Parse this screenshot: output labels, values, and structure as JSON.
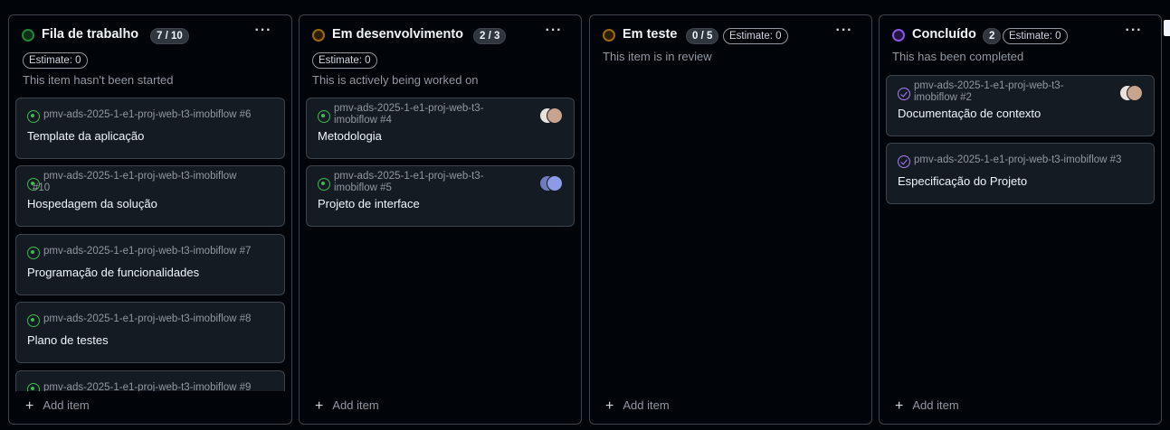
{
  "repo_prefix": "pmv-ads-2025-1-e1-proj-web-t3-imobiflow",
  "add_item_label": "Add item",
  "more_icon": "kebab-horizontal-icon",
  "colors": {
    "todo": "#238636",
    "in_progress": "#9e6a03",
    "review": "#9e6a03",
    "done": "#8957e5",
    "open_issue": "#3fb950",
    "closed_issue": "#ab7df8"
  },
  "columns": [
    {
      "title": "Fila de trabalho",
      "count": "7 / 10",
      "estimate": "Estimate: 0",
      "description": "This item hasn't been started",
      "cards": [
        {
          "ref_line1": "pmv-ads-2025-1-e1-proj-web-t3-imobiflow #6",
          "ref_line2": "",
          "title": "Template da aplicação"
        },
        {
          "ref_line1": "pmv-ads-2025-1-e1-proj-web-t3-imobiflow",
          "ref_line2": "#10",
          "title": "Hospedagem da solução"
        },
        {
          "ref_line1": "pmv-ads-2025-1-e1-proj-web-t3-imobiflow #7",
          "ref_line2": "",
          "title": "Programação de funcionalidades"
        },
        {
          "ref_line1": "pmv-ads-2025-1-e1-proj-web-t3-imobiflow #8",
          "ref_line2": "",
          "title": "Plano de testes"
        },
        {
          "ref_line1": "pmv-ads-2025-1-e1-proj-web-t3-imobiflow #9",
          "ref_line2": "",
          "title": ""
        }
      ]
    },
    {
      "title": "Em desenvolvimento",
      "count": "2 / 3",
      "estimate": "Estimate: 0",
      "description": "This is actively being worked on",
      "cards": [
        {
          "ref_line1": "pmv-ads-2025-1-e1-proj-web-t3-",
          "ref_line2": "imobiflow #4",
          "title": "Metodologia"
        },
        {
          "ref_line1": "pmv-ads-2025-1-e1-proj-web-t3-",
          "ref_line2": "imobiflow #5",
          "title": "Projeto de interface"
        }
      ]
    },
    {
      "title": "Em teste",
      "count": "0 / 5",
      "estimate": "Estimate: 0",
      "description": "This item is in review",
      "cards": []
    },
    {
      "title": "Concluído",
      "count": "2",
      "estimate": "Estimate: 0",
      "description": "This has been completed",
      "cards": [
        {
          "ref_line1": "pmv-ads-2025-1-e1-proj-web-t3-",
          "ref_line2": "imobiflow #2",
          "title": "Documentação de contexto"
        },
        {
          "ref_line1": "pmv-ads-2025-1-e1-proj-web-t3-imobiflow #3",
          "ref_line2": "",
          "title": "Especificação do Projeto"
        }
      ]
    }
  ]
}
